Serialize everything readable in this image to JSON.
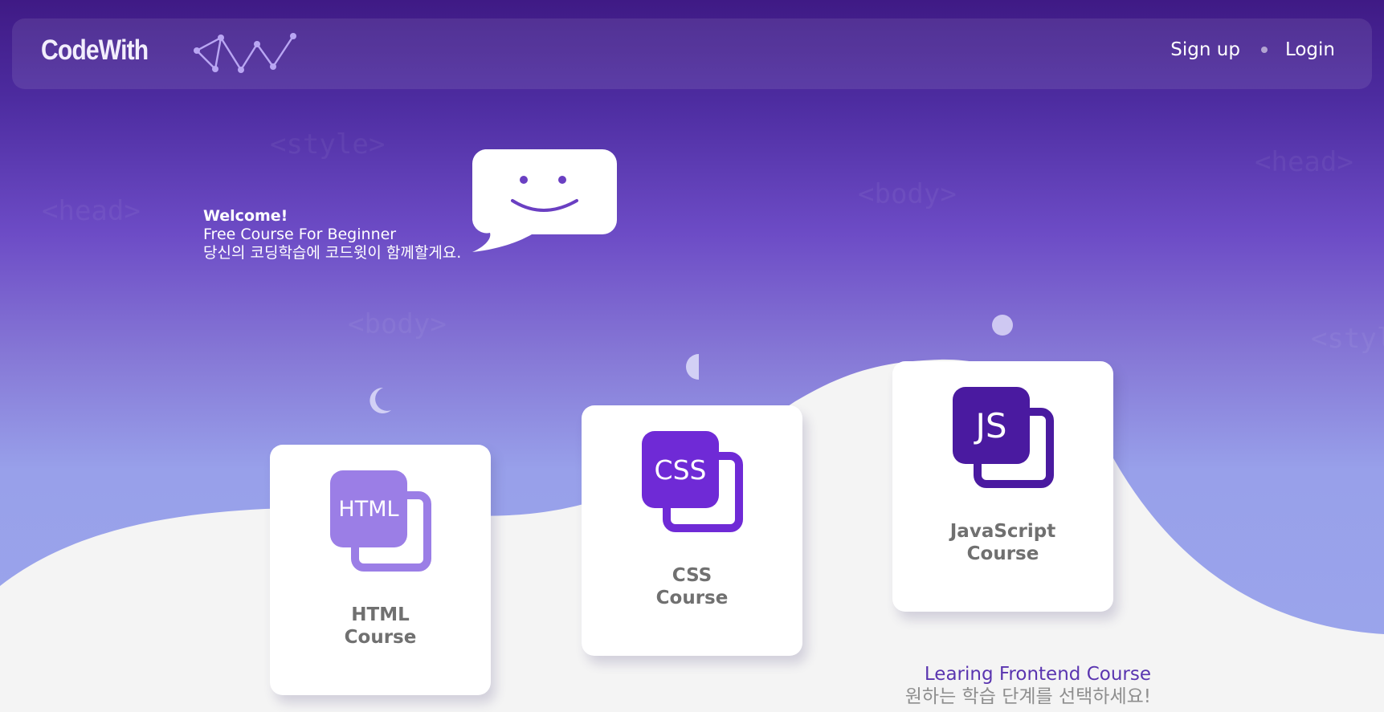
{
  "brand": {
    "name": "CodeWith",
    "mark_icon": "constellation-icon"
  },
  "nav": {
    "signup_label": "Sign up",
    "login_label": "Login"
  },
  "ghost_tags": {
    "a": "<style>",
    "b": "<head>",
    "c": "<body>",
    "d": "<head>",
    "e": "<body>",
    "f": "<styl"
  },
  "hero": {
    "title": "Welcome!",
    "subtitle": "Free Course For Beginner",
    "message": "당신의 코딩학습에 코드윗이 함께할게요.",
    "bubble_icon": "smiley-speech-bubble-icon"
  },
  "courses": [
    {
      "icon_text": "HTML",
      "label_line1": "HTML",
      "label_line2": "Course",
      "color": "#9b7ee6"
    },
    {
      "icon_text": "CSS",
      "label_line1": "CSS",
      "label_line2": "Course",
      "color": "#6f2ad6"
    },
    {
      "icon_text": "JS",
      "label_line1": "JavaScript",
      "label_line2": "Course",
      "color": "#4a1aa0"
    }
  ],
  "tagline": {
    "line1": "Learing Frontend Course",
    "line2": "원하는 학습 단계를 선택하세요!"
  },
  "colors": {
    "accent": "#5a35b0",
    "background_light": "#f4f4f4",
    "text_muted": "#707070"
  }
}
